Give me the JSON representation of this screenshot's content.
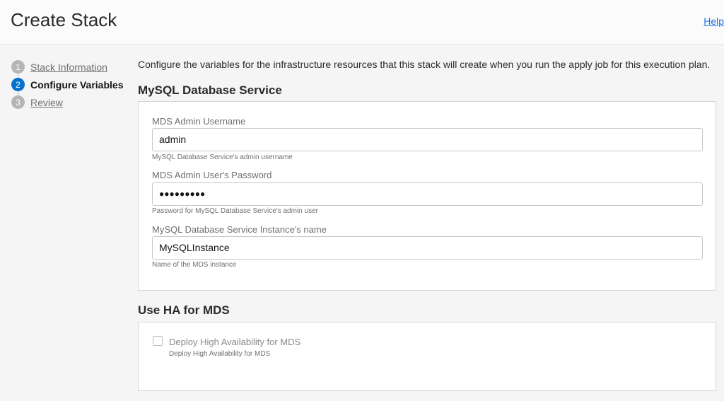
{
  "header": {
    "title": "Create Stack",
    "help": "Help"
  },
  "steps": [
    {
      "num": "1",
      "label": "Stack Information"
    },
    {
      "num": "2",
      "label": "Configure Variables"
    },
    {
      "num": "3",
      "label": "Review"
    }
  ],
  "intro": "Configure the variables for the infrastructure resources that this stack will create when you run the apply job for this execution plan.",
  "mds": {
    "title": "MySQL Database Service",
    "fields": [
      {
        "label": "MDS Admin Username",
        "value": "admin",
        "hint": "MySQL Database Service's admin username"
      },
      {
        "label": "MDS Admin User's Password",
        "value": "●●●●●●●●●",
        "hint": "Password for MySQL Database Service's admin user"
      },
      {
        "label": "MySQL Database Service Instance's name",
        "value": "MySQLInstance",
        "hint": "Name of the MDS instance"
      }
    ]
  },
  "ha": {
    "title": "Use HA for MDS",
    "checkbox_label": "Deploy High Availability for MDS",
    "checkbox_hint": "Deploy High Availability for MDS",
    "checked": false
  }
}
